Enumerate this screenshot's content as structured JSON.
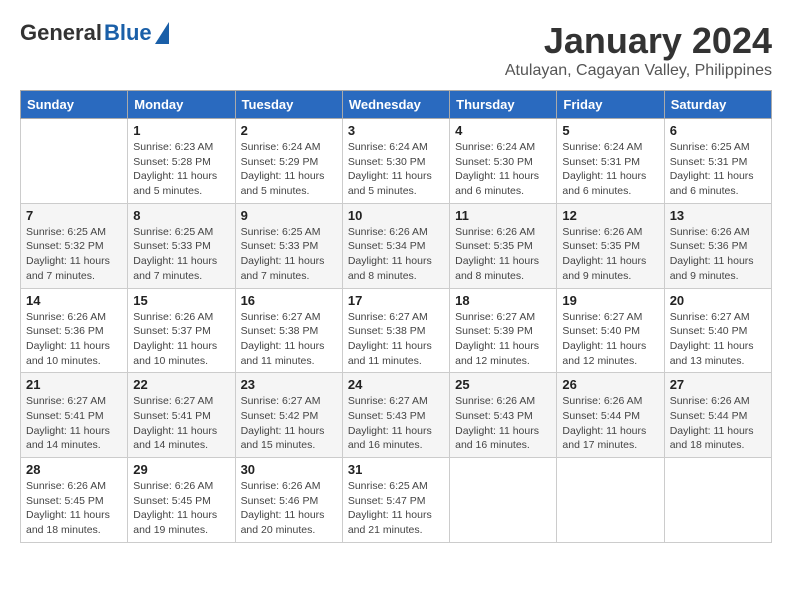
{
  "header": {
    "logo_general": "General",
    "logo_blue": "Blue",
    "month": "January 2024",
    "location": "Atulayan, Cagayan Valley, Philippines"
  },
  "days_of_week": [
    "Sunday",
    "Monday",
    "Tuesday",
    "Wednesday",
    "Thursday",
    "Friday",
    "Saturday"
  ],
  "weeks": [
    [
      {
        "day": "",
        "info": ""
      },
      {
        "day": "1",
        "info": "Sunrise: 6:23 AM\nSunset: 5:28 PM\nDaylight: 11 hours and 5 minutes."
      },
      {
        "day": "2",
        "info": "Sunrise: 6:24 AM\nSunset: 5:29 PM\nDaylight: 11 hours and 5 minutes."
      },
      {
        "day": "3",
        "info": "Sunrise: 6:24 AM\nSunset: 5:30 PM\nDaylight: 11 hours and 5 minutes."
      },
      {
        "day": "4",
        "info": "Sunrise: 6:24 AM\nSunset: 5:30 PM\nDaylight: 11 hours and 6 minutes."
      },
      {
        "day": "5",
        "info": "Sunrise: 6:24 AM\nSunset: 5:31 PM\nDaylight: 11 hours and 6 minutes."
      },
      {
        "day": "6",
        "info": "Sunrise: 6:25 AM\nSunset: 5:31 PM\nDaylight: 11 hours and 6 minutes."
      }
    ],
    [
      {
        "day": "7",
        "info": "Sunrise: 6:25 AM\nSunset: 5:32 PM\nDaylight: 11 hours and 7 minutes."
      },
      {
        "day": "8",
        "info": "Sunrise: 6:25 AM\nSunset: 5:33 PM\nDaylight: 11 hours and 7 minutes."
      },
      {
        "day": "9",
        "info": "Sunrise: 6:25 AM\nSunset: 5:33 PM\nDaylight: 11 hours and 7 minutes."
      },
      {
        "day": "10",
        "info": "Sunrise: 6:26 AM\nSunset: 5:34 PM\nDaylight: 11 hours and 8 minutes."
      },
      {
        "day": "11",
        "info": "Sunrise: 6:26 AM\nSunset: 5:35 PM\nDaylight: 11 hours and 8 minutes."
      },
      {
        "day": "12",
        "info": "Sunrise: 6:26 AM\nSunset: 5:35 PM\nDaylight: 11 hours and 9 minutes."
      },
      {
        "day": "13",
        "info": "Sunrise: 6:26 AM\nSunset: 5:36 PM\nDaylight: 11 hours and 9 minutes."
      }
    ],
    [
      {
        "day": "14",
        "info": "Sunrise: 6:26 AM\nSunset: 5:36 PM\nDaylight: 11 hours and 10 minutes."
      },
      {
        "day": "15",
        "info": "Sunrise: 6:26 AM\nSunset: 5:37 PM\nDaylight: 11 hours and 10 minutes."
      },
      {
        "day": "16",
        "info": "Sunrise: 6:27 AM\nSunset: 5:38 PM\nDaylight: 11 hours and 11 minutes."
      },
      {
        "day": "17",
        "info": "Sunrise: 6:27 AM\nSunset: 5:38 PM\nDaylight: 11 hours and 11 minutes."
      },
      {
        "day": "18",
        "info": "Sunrise: 6:27 AM\nSunset: 5:39 PM\nDaylight: 11 hours and 12 minutes."
      },
      {
        "day": "19",
        "info": "Sunrise: 6:27 AM\nSunset: 5:40 PM\nDaylight: 11 hours and 12 minutes."
      },
      {
        "day": "20",
        "info": "Sunrise: 6:27 AM\nSunset: 5:40 PM\nDaylight: 11 hours and 13 minutes."
      }
    ],
    [
      {
        "day": "21",
        "info": "Sunrise: 6:27 AM\nSunset: 5:41 PM\nDaylight: 11 hours and 14 minutes."
      },
      {
        "day": "22",
        "info": "Sunrise: 6:27 AM\nSunset: 5:41 PM\nDaylight: 11 hours and 14 minutes."
      },
      {
        "day": "23",
        "info": "Sunrise: 6:27 AM\nSunset: 5:42 PM\nDaylight: 11 hours and 15 minutes."
      },
      {
        "day": "24",
        "info": "Sunrise: 6:27 AM\nSunset: 5:43 PM\nDaylight: 11 hours and 16 minutes."
      },
      {
        "day": "25",
        "info": "Sunrise: 6:26 AM\nSunset: 5:43 PM\nDaylight: 11 hours and 16 minutes."
      },
      {
        "day": "26",
        "info": "Sunrise: 6:26 AM\nSunset: 5:44 PM\nDaylight: 11 hours and 17 minutes."
      },
      {
        "day": "27",
        "info": "Sunrise: 6:26 AM\nSunset: 5:44 PM\nDaylight: 11 hours and 18 minutes."
      }
    ],
    [
      {
        "day": "28",
        "info": "Sunrise: 6:26 AM\nSunset: 5:45 PM\nDaylight: 11 hours and 18 minutes."
      },
      {
        "day": "29",
        "info": "Sunrise: 6:26 AM\nSunset: 5:45 PM\nDaylight: 11 hours and 19 minutes."
      },
      {
        "day": "30",
        "info": "Sunrise: 6:26 AM\nSunset: 5:46 PM\nDaylight: 11 hours and 20 minutes."
      },
      {
        "day": "31",
        "info": "Sunrise: 6:25 AM\nSunset: 5:47 PM\nDaylight: 11 hours and 21 minutes."
      },
      {
        "day": "",
        "info": ""
      },
      {
        "day": "",
        "info": ""
      },
      {
        "day": "",
        "info": ""
      }
    ]
  ]
}
